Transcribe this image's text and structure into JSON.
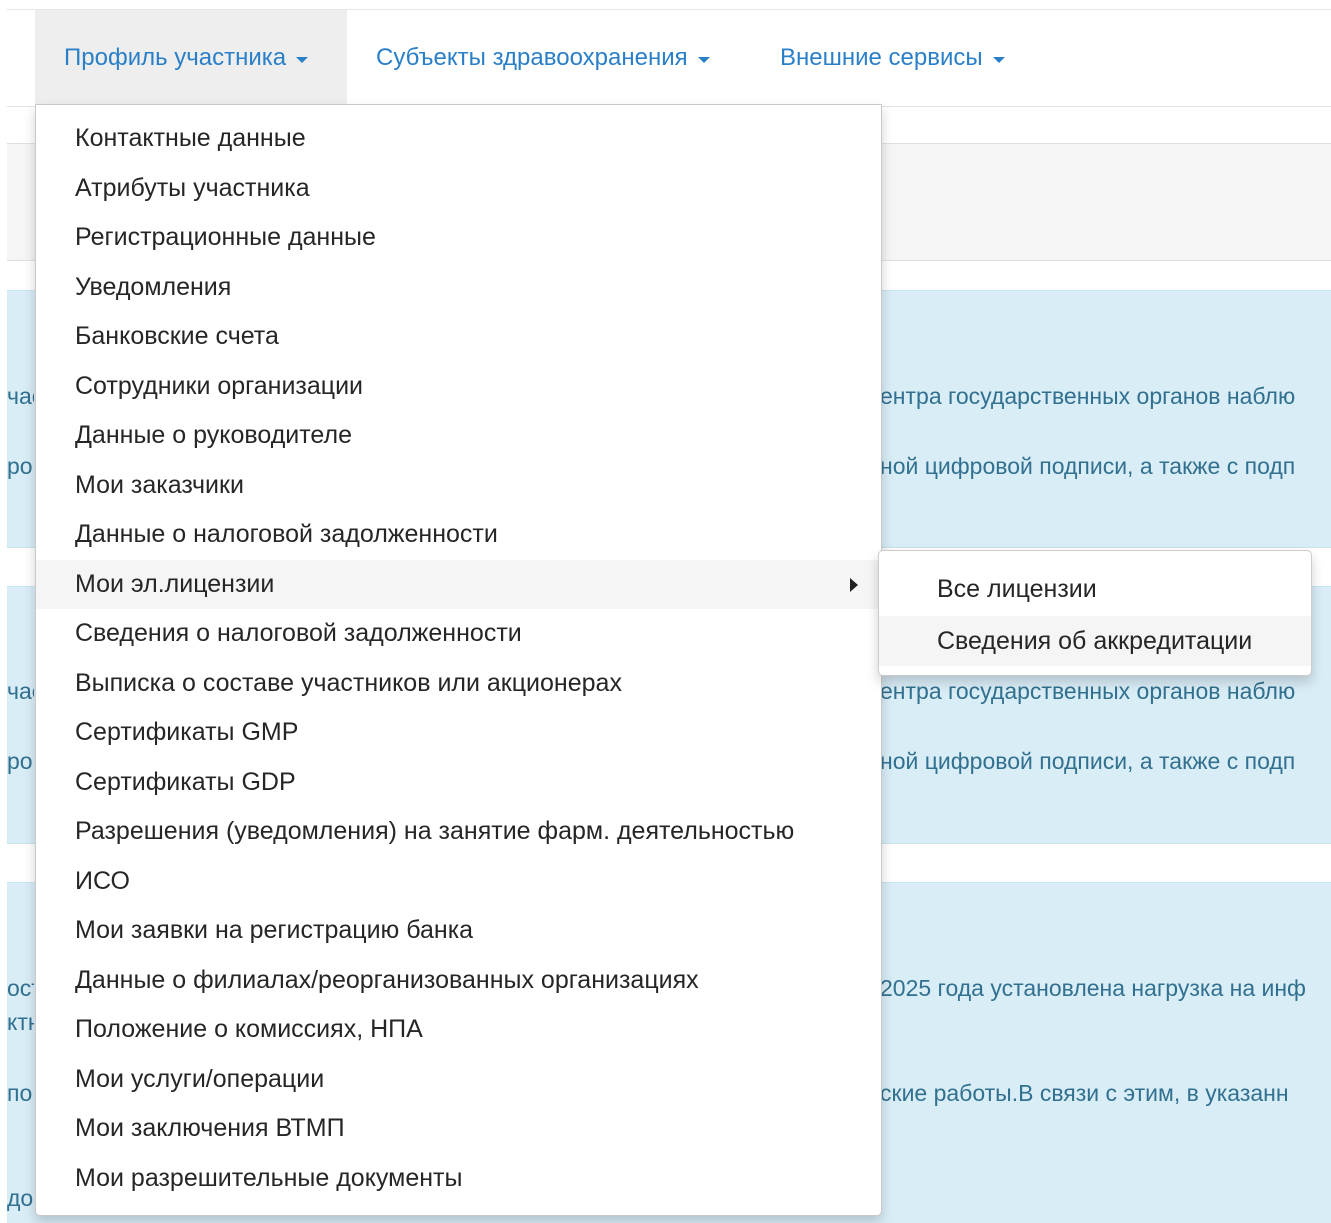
{
  "nav": {
    "items": [
      {
        "label": "Профиль участника"
      },
      {
        "label": "Субъекты здравоохранения"
      },
      {
        "label": "Внешние сервисы"
      }
    ]
  },
  "background": {
    "fragments": {
      "a1_left1": "час",
      "a1_left2": "роб",
      "a1_right1": "ентра государственных органов наблю",
      "a1_right2": "ной цифровой подписи, а также с подп",
      "a2_left1": "час",
      "a2_left2": "роб",
      "a2_right1": "ентра государственных органов наблю",
      "a2_right2": "ной цифровой подписи, а также с подп",
      "a3_left1": "ост",
      "a3_left2": "ктн",
      "a3_left3": "по",
      "a3_left4": "доб",
      "a3_right1": "2025 года установлена нагрузка на инф",
      "a3_right2": "ские работы.В связи с этим, в указанн"
    }
  },
  "menu": {
    "items": [
      {
        "label": "Контактные данные"
      },
      {
        "label": "Атрибуты участника"
      },
      {
        "label": "Регистрационные данные"
      },
      {
        "label": "Уведомления"
      },
      {
        "label": "Банковские счета"
      },
      {
        "label": "Сотрудники организации"
      },
      {
        "label": "Данные о руководителе"
      },
      {
        "label": "Мои заказчики"
      },
      {
        "label": "Данные о налоговой задолженности"
      },
      {
        "label": "Мои эл.лицензии"
      },
      {
        "label": "Сведения о налоговой задолженности"
      },
      {
        "label": "Выписка о составе участников или акционерах"
      },
      {
        "label": "Сертификаты GMP"
      },
      {
        "label": "Сертификаты GDP"
      },
      {
        "label": "Разрешения (уведомления) на занятие фарм. деятельностью"
      },
      {
        "label": "ИСО"
      },
      {
        "label": "Мои заявки на регистрацию банка"
      },
      {
        "label": "Данные о филиалах/реорганизованных организациях"
      },
      {
        "label": "Положение о комиссиях, НПА"
      },
      {
        "label": "Мои услуги/операции"
      },
      {
        "label": "Мои заключения ВТМП"
      },
      {
        "label": "Мои разрешительные документы"
      }
    ]
  },
  "submenu": {
    "items": [
      {
        "label": "Все лицензии"
      },
      {
        "label": "Сведения об аккредитации"
      }
    ]
  },
  "colors": {
    "link": "#2a7fc9",
    "alert_bg": "#d9edf7",
    "alert_text": "#31708f",
    "hover_bg": "#f5f5f5"
  }
}
